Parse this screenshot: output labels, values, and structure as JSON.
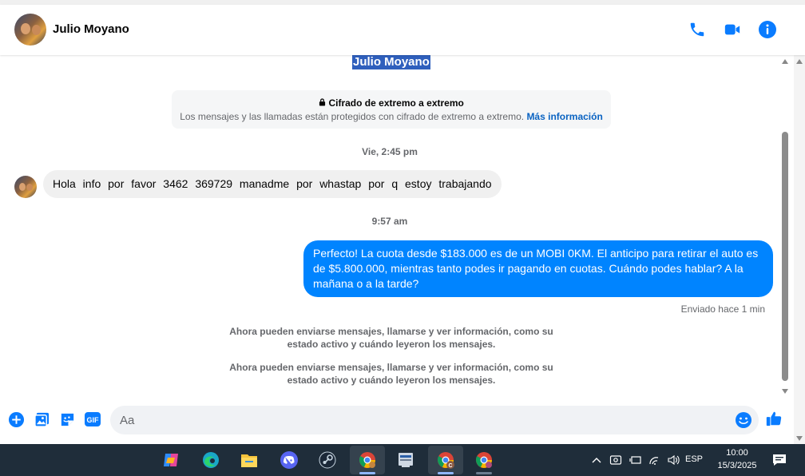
{
  "header": {
    "contact_name": "Julio Moyano",
    "icons": [
      "phone-icon",
      "video-icon",
      "info-icon"
    ]
  },
  "thread": {
    "selected_name": "Julio Moyano",
    "e2e": {
      "title": "Cifrado de extremo a extremo",
      "text": "Los mensajes y las llamadas están protegidos con cifrado de extremo a extremo.",
      "link": "Más información"
    },
    "timestamp1": "Vie, 2:45 pm",
    "incoming_message": "Hola info por favor 3462 369729  manadme por whastap por q estoy trabajando",
    "timestamp2": "9:57 am",
    "outgoing_message": "Perfecto! La cuota desde $183.000 es de un MOBI 0KM. El anticipo para retirar el auto es de $5.800.000, mientras tanto podes ir pagando en cuotas. Cuándo podes hablar? A la mañana o a la tarde?",
    "sent_status": "Enviado hace 1 min",
    "info_notice_1": "Ahora pueden enviarse mensajes, llamarse y ver información, como su estado activo y cuándo leyeron los mensajes.",
    "info_notice_2": "Ahora pueden enviarse mensajes, llamarse y ver información, como su estado activo y cuándo leyeron los mensajes."
  },
  "composer": {
    "placeholder": "Aa",
    "gif_label": "GIF"
  },
  "taskbar": {
    "language": "ESP",
    "time": "10:00",
    "date": "15/3/2025",
    "chrome_badge": "C"
  },
  "colors": {
    "accent": "#0084ff",
    "link": "#0a63c2",
    "taskbar": "#1f2d3a"
  }
}
